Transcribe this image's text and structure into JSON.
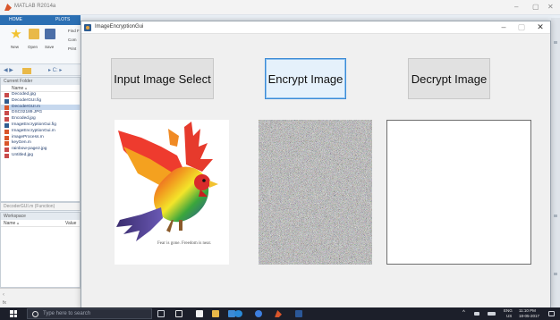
{
  "matlab": {
    "window_title": "MATLAB R2014a",
    "window_controls": {
      "minimize": "–",
      "maximize": "▢",
      "close": "✕"
    },
    "ribbon_tabs": [
      "HOME",
      "PLOTS"
    ],
    "ribbon_buttons": [
      "New",
      "Open",
      "Save"
    ],
    "ribbon_side": [
      "Find F",
      "Com",
      "Print"
    ],
    "path_arrows": "◀ ▶",
    "path_text": "▸ C: ▸",
    "current_folder": {
      "header": "Current Folder",
      "column": "Name ▵",
      "files": [
        "Decoded.jpg",
        "DecoderGUI.fig",
        "DecoderGUI.m",
        "DSC02189.JPG",
        "Encoded.jpg",
        "ImageEncryptionGui.fig",
        "ImageEncryptionGui.m",
        "imageProcess.m",
        "keyGen.m",
        "rainbow-page2.jpg",
        "Untitled.jpg"
      ],
      "selected_index": 2
    },
    "details": "DecoderGUI.m (Function)",
    "workspace": {
      "header": "Workspace",
      "name_col": "Name ▵",
      "value_col": "Value"
    },
    "colors": {
      "ribbon_blue": "#2b6fb3",
      "selected_row": "#c6d8ee"
    }
  },
  "gui": {
    "title": "ImageEncryptionGui",
    "window_controls": {
      "minimize": "–",
      "maximize": "▢",
      "close": "✕"
    },
    "buttons": {
      "input": "Input Image Select",
      "encrypt": "Encrypt Image",
      "decrypt": "Decrypt Image"
    },
    "images": {
      "original_caption": "Fear is gone. Freedom is near."
    },
    "colors": {
      "button_face": "#e1e1e1",
      "focus_border": "#3c8bd6"
    }
  },
  "taskbar": {
    "search_placeholder": "Type here to search",
    "tray_lang": "ENG",
    "tray_locale": "US",
    "time": "11:10 PM",
    "date": "18-05-2017",
    "apps": [
      "task-view",
      "edge",
      "file-explorer",
      "store",
      "ie",
      "chrome",
      "matlab",
      "word"
    ]
  }
}
